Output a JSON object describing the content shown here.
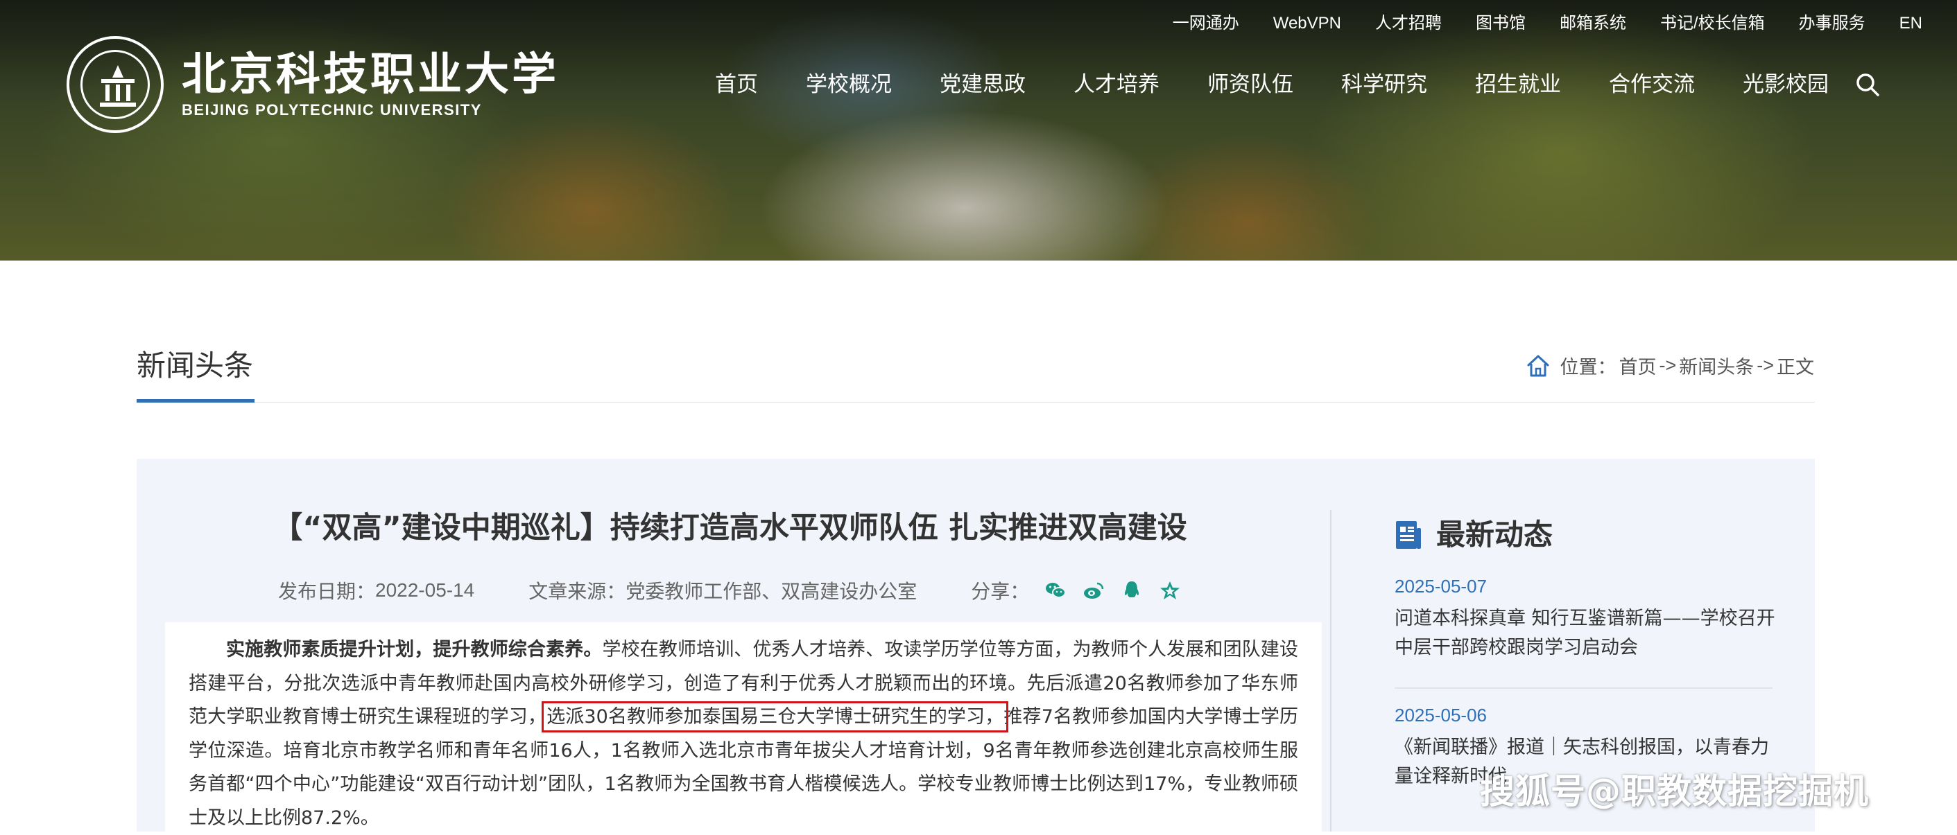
{
  "header": {
    "logo_cn": "北京科技职业大学",
    "logo_en": "BEIJING POLYTECHNIC UNIVERSITY",
    "top_links": [
      "一网通办",
      "WebVPN",
      "人才招聘",
      "图书馆",
      "邮箱系统",
      "书记/校长信箱",
      "办事服务",
      "EN"
    ],
    "main_nav": [
      "首页",
      "学校概况",
      "党建思政",
      "人才培养",
      "师资队伍",
      "科学研究",
      "招生就业",
      "合作交流",
      "光影校园"
    ],
    "search_icon": "search-icon"
  },
  "section": {
    "title": "新闻头条",
    "breadcrumb": {
      "label": "位置：",
      "home": "首页",
      "sep": "->",
      "category": "新闻头条",
      "current": "正文"
    }
  },
  "article": {
    "title": "【“双高”建设中期巡礼】持续打造高水平双师队伍 扎实推进双高建设",
    "date_label": "发布日期：",
    "date": "2022-05-14",
    "source_label": "文章来源：",
    "source": "党委教师工作部、双高建设办公室",
    "share_label": "分享：",
    "share_icons": [
      "wechat-icon",
      "weibo-icon",
      "qq-icon",
      "qzone-icon"
    ],
    "body": {
      "lead_bold": "实施教师素质提升计划，提升教师综合素养。",
      "text_1": "学校在教师培训、优秀人才培养、攻读学历学位等方面，为教师个人发展和团队建设搭建平台，分批次选派中青年教师赴国内高校外研修学习，创造了有利于优秀人才脱颖而出的环境。先后派遣20名教师参加了华东师范大学职业教育博士研究生课程班的学习，",
      "highlight": "选派30名教师参加泰国易三仓大学博士研究生的学习，",
      "text_2": "推荐7名教师参加国内大学博士学历学位深造。培育北京市教学名师和青年名师16人，1名教师入选北京市青年拔尖人才培育计划，9名青年教师参选创建北京高校师生服务首都“四个中心”功能建设“双百行动计划”团队，1名教师为全国教书育人楷模候选人。学校专业教师博士比例达到17%，专业教师硕士及以上比例87.2%。"
    },
    "highlight_color": "#d0121b"
  },
  "sidebar": {
    "title": "最新动态",
    "items": [
      {
        "date": "2025-05-07",
        "title": "问道本科探真章 知行互鉴谱新篇——学校召开中层干部跨校跟岗学习启动会"
      },
      {
        "date": "2025-05-06",
        "title": "《新闻联播》报道｜矢志科创报国，以青春力量诠释新时代"
      }
    ]
  },
  "watermark": "搜狐号@职教数据挖掘机",
  "colors": {
    "accent": "#2f6fb8",
    "highlight": "#d0121b",
    "panel_bg": "#f1f5fb"
  }
}
